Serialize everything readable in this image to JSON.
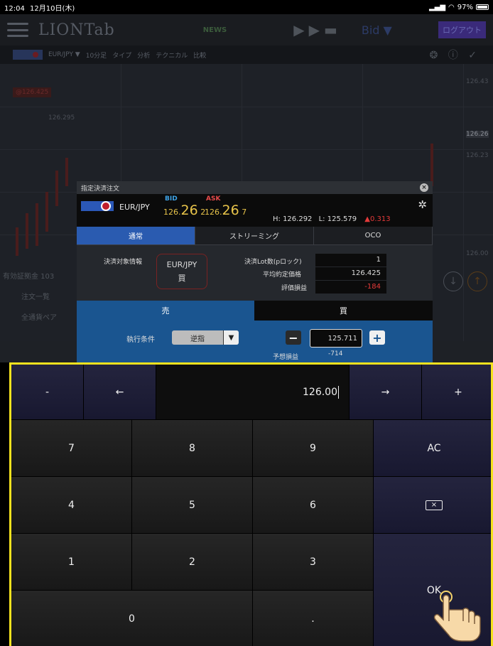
{
  "status_bar": {
    "time": "12:04",
    "date": "12月10日(木)",
    "battery": "97%"
  },
  "header": {
    "logo": "LIONTab",
    "news": "NEWS",
    "bid_select": "Bid ▼",
    "logout": "ログアウト"
  },
  "chart_toolbar": {
    "pair": "EUR/JPY ▼",
    "items": [
      "10分足",
      "タイプ",
      "分析",
      "テクニカル",
      "比較"
    ]
  },
  "chart": {
    "price_tag": "@126.425",
    "left_label": "126.295",
    "right_labels": [
      "126.43",
      "126.26",
      "126.23",
      "126.00"
    ]
  },
  "left_panel": {
    "margin": "有効証拠金 103",
    "order_list": "注文一覧",
    "all_pairs": "全通貨ペア"
  },
  "dialog": {
    "title": "指定決済注文",
    "pair": "EUR/JPY",
    "bid_label": "BID",
    "ask_label": "ASK",
    "bid_prefix": "126.",
    "bid_big": "26",
    "bid_suffix": "2",
    "ask_prefix": "126.",
    "ask_big": "26",
    "ask_suffix": "7",
    "high": "H: 126.292",
    "low": "L: 125.579",
    "change": "▲0.313",
    "tabs": [
      "通常",
      "ストリーミング",
      "OCO"
    ],
    "target_label": "決済対象情報",
    "target_pair": "EUR/JPY",
    "target_side": "買",
    "lot_label": "決済Lot数(pロック)",
    "lot_value": "1",
    "avg_label": "平均約定価格",
    "avg_value": "126.425",
    "pl_label": "評価損益",
    "pl_value": "-184",
    "sell_label": "売",
    "buy_label": "買",
    "exec_label": "執行条件",
    "exec_value": "逆指",
    "price_value": "125.711",
    "est_label": "予想損益",
    "est_value": "-714"
  },
  "keypad": {
    "minus": "-",
    "left": "←",
    "display": "126.00",
    "right": "→",
    "plus": "+",
    "digits": [
      "7",
      "8",
      "9",
      "4",
      "5",
      "6",
      "1",
      "2",
      "3",
      "0",
      "."
    ],
    "ac": "AC",
    "ok": "OK"
  },
  "colors": {
    "highlight_border": "#f5e21e",
    "sell_blue": "#1a5590",
    "active_tab": "#2a5bb0"
  }
}
